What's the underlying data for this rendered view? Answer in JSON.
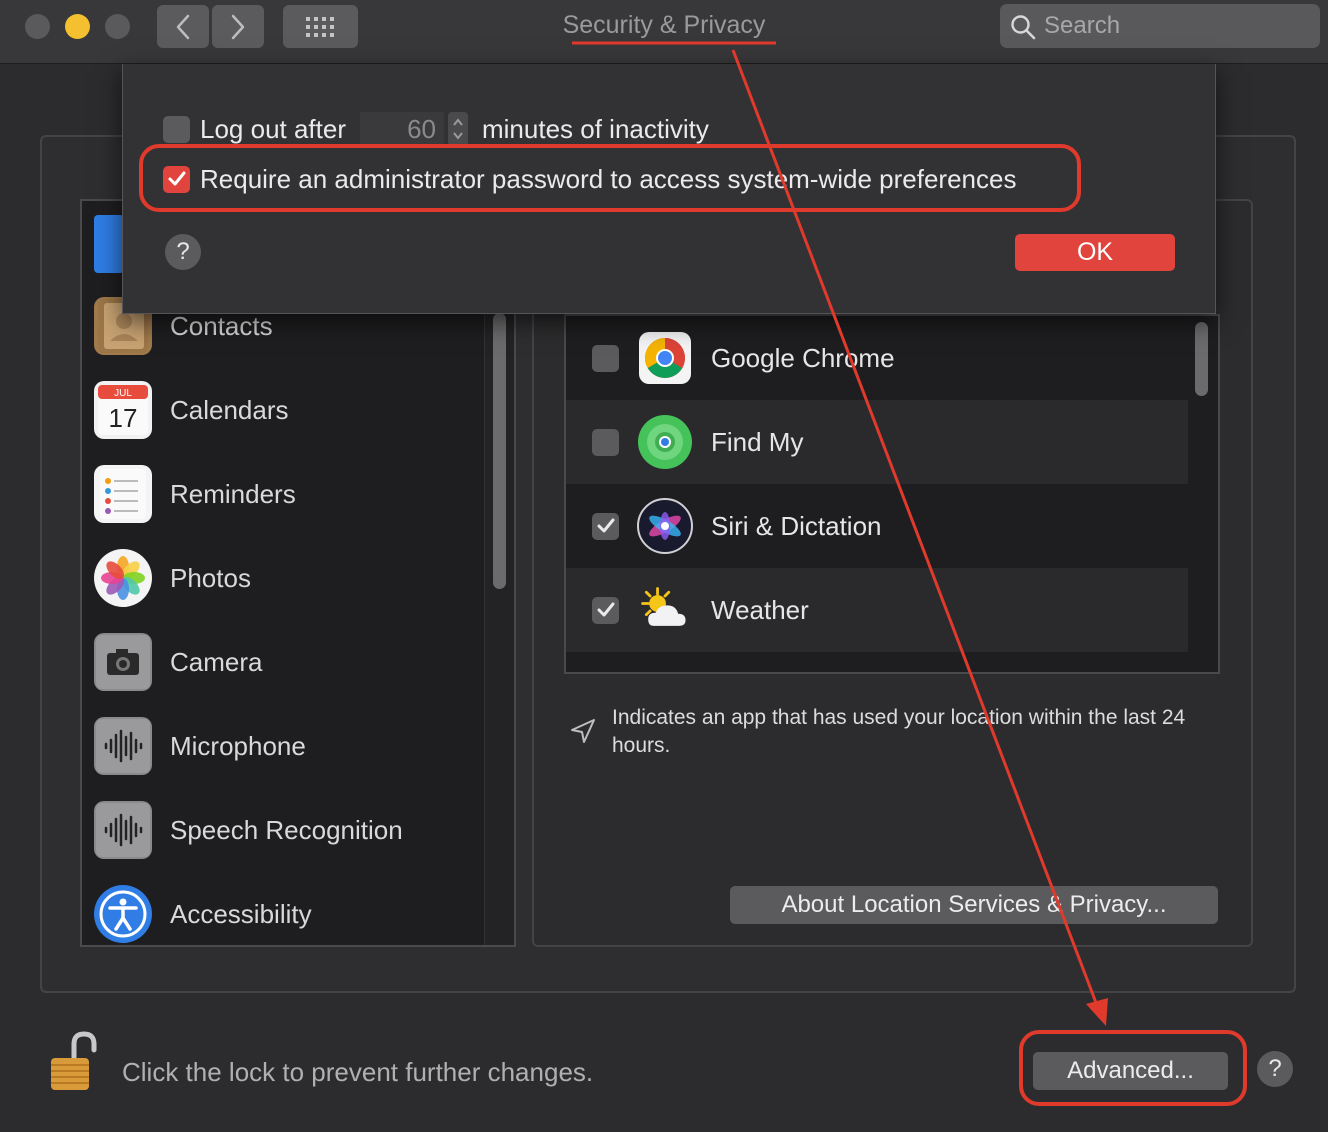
{
  "window": {
    "title": "Security & Privacy",
    "search_placeholder": "Search"
  },
  "sidebar": {
    "items": [
      {
        "label": "Contacts",
        "icon": "contacts-icon"
      },
      {
        "label": "Calendars",
        "icon": "calendar-icon",
        "icon_month": "JUL",
        "icon_day": "17"
      },
      {
        "label": "Reminders",
        "icon": "reminders-icon"
      },
      {
        "label": "Photos",
        "icon": "photos-icon"
      },
      {
        "label": "Camera",
        "icon": "camera-icon"
      },
      {
        "label": "Microphone",
        "icon": "microphone-icon"
      },
      {
        "label": "Speech Recognition",
        "icon": "speech-recognition-icon"
      },
      {
        "label": "Accessibility",
        "icon": "accessibility-icon"
      }
    ]
  },
  "apps": {
    "rows": [
      {
        "name": "Google Chrome",
        "checked": false,
        "icon": "chrome-icon"
      },
      {
        "name": "Find My",
        "checked": false,
        "icon": "find-my-icon"
      },
      {
        "name": "Siri & Dictation",
        "checked": true,
        "icon": "siri-icon"
      },
      {
        "name": "Weather",
        "checked": true,
        "icon": "weather-icon"
      }
    ]
  },
  "location_note": "Indicates an app that has used your location within the last 24 hours.",
  "about_button": "About Location Services & Privacy...",
  "lock_text": "Click the lock to prevent further changes.",
  "advanced_button": "Advanced...",
  "help_label": "?",
  "sheet": {
    "logout_label": "Log out after",
    "logout_checked": false,
    "logout_minutes": "60",
    "logout_suffix": "minutes of inactivity",
    "admin_label": "Require an administrator password to access system-wide preferences",
    "admin_checked": true,
    "ok_button": "OK"
  },
  "colors": {
    "accent_red": "#e0443c",
    "annotation_red": "#e03a2c",
    "window_bg": "#2c2c2e"
  }
}
